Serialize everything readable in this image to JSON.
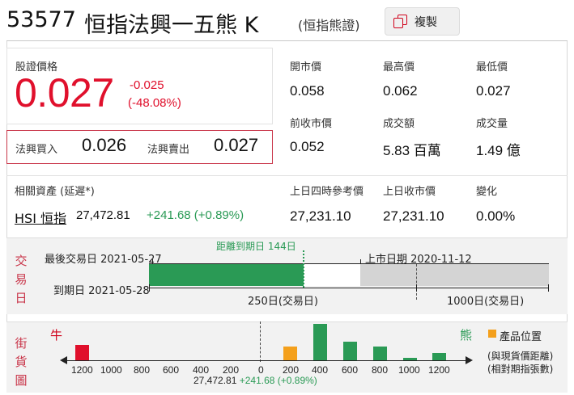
{
  "header": {
    "code": "53577",
    "name": "恒指法興一五熊 K",
    "type": "(恒指熊證)",
    "copy_label": "複製"
  },
  "price": {
    "label": "股證價格",
    "value": "0.027",
    "change": "-0.025",
    "change_pct": "(-48.08%)",
    "bid_label": "法興買入",
    "bid": "0.026",
    "ask_label": "法興賣出",
    "ask": "0.027"
  },
  "stats": [
    {
      "label": "開市價",
      "value": "0.058"
    },
    {
      "label": "最高價",
      "value": "0.062"
    },
    {
      "label": "最低價",
      "value": "0.027"
    },
    {
      "label": "前收市價",
      "value": "0.052"
    },
    {
      "label": "成交額",
      "value": "5.83 百萬"
    },
    {
      "label": "成交量",
      "value": "1.49 億"
    }
  ],
  "related": {
    "label": "相關資產 (延遲*)",
    "link": "HSI 恒指",
    "value": "27,472.81",
    "change": "+241.68 (+0.89%)",
    "cols": [
      {
        "label": "上日四時參考價",
        "value": "27,231.10"
      },
      {
        "label": "上日收市價",
        "value": "27,231.10"
      },
      {
        "label": "變化",
        "value": "0.00%"
      }
    ]
  },
  "timeline": {
    "section_label": [
      "交",
      "易",
      "日"
    ],
    "last_trade": "最後交易日 2021-05-27",
    "distance": "距離到期日 144日",
    "listing": "上市日期 2020-11-12",
    "expiry": "到期日 2021-05-28",
    "scale_250": "250日(交易日)",
    "scale_1000": "1000日(交易日)",
    "colors": {
      "elapsed": "#2a9a55",
      "remaining": "#ffffff",
      "history": "#d4d4d4"
    }
  },
  "street": {
    "section_label": [
      "街",
      "貨",
      "圖"
    ],
    "bull_label": "牛",
    "bear_label": "熊",
    "legend": "產品位置",
    "note1": "(與現貨價距離)",
    "note2": "(相對期指張數)",
    "center_value": "27,472.81",
    "center_change": "+241.68 (+0.89%)",
    "x_ticks": [
      "1200",
      "1000",
      "800",
      "600",
      "400",
      "200",
      "0",
      "200",
      "400",
      "600",
      "800",
      "1000",
      "1200"
    ],
    "colors": {
      "bull": "#e0102c",
      "bear": "#2a9a55",
      "product": "#f4a01c"
    }
  },
  "chart_data": {
    "type": "bar",
    "title": "",
    "xlabel": "",
    "ylabel": "",
    "x": [
      -1200,
      200,
      400,
      600,
      800,
      1000,
      1200
    ],
    "values": [
      0.42,
      0.38,
      1.0,
      0.5,
      0.37,
      0.07,
      0.19
    ],
    "categories": [
      "bull",
      "product",
      "bear",
      "bear",
      "bear",
      "bear",
      "bear"
    ]
  }
}
